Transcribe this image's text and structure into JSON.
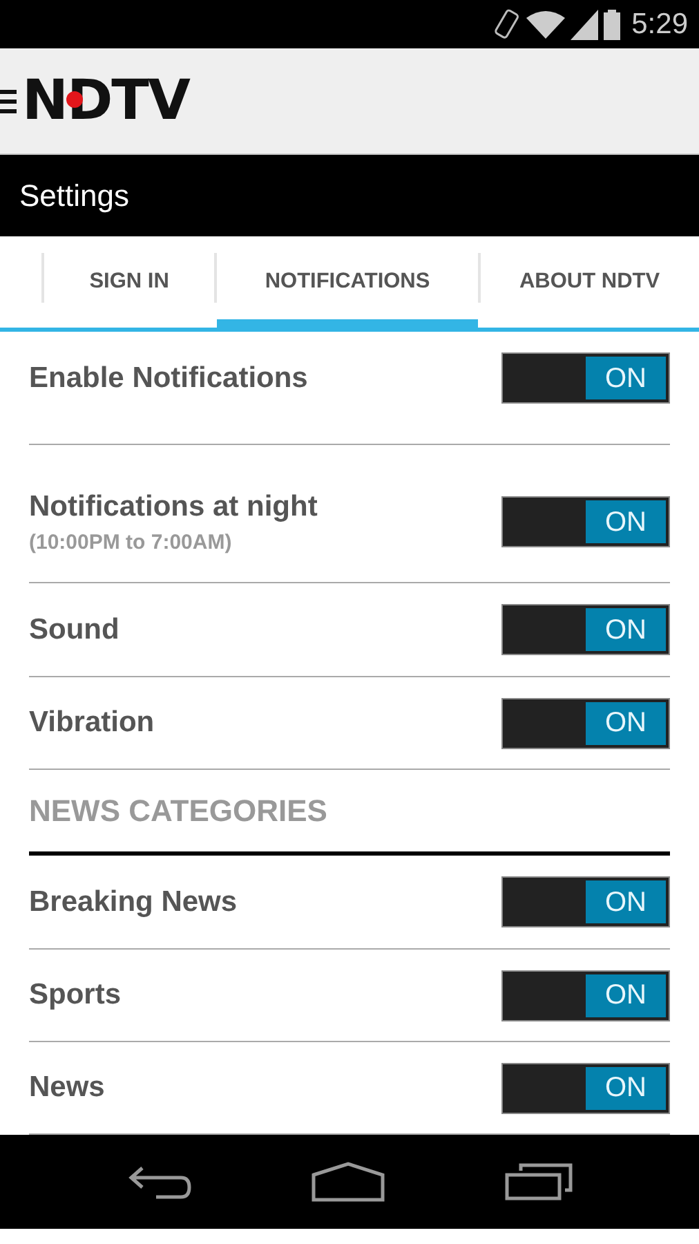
{
  "status_bar": {
    "time": "5:29"
  },
  "app_bar": {
    "logo": "NDTV"
  },
  "title": "Settings",
  "tabs": [
    {
      "label": "SIGN IN",
      "selected": false
    },
    {
      "label": "NOTIFICATIONS",
      "selected": true
    },
    {
      "label": "ABOUT NDTV",
      "selected": false
    }
  ],
  "settings": [
    {
      "label": "Enable Notifications",
      "on": true,
      "switch_text": "ON"
    },
    {
      "label": "Notifications at night",
      "sublabel": "(10:00PM to 7:00AM)",
      "on": true,
      "switch_text": "ON"
    },
    {
      "label": "Sound",
      "on": true,
      "switch_text": "ON"
    },
    {
      "label": "Vibration",
      "on": true,
      "switch_text": "ON"
    }
  ],
  "news_categories": {
    "heading": "NEWS CATEGORIES",
    "items": [
      {
        "label": "Breaking News",
        "on": true,
        "switch_text": "ON"
      },
      {
        "label": "Sports",
        "on": true,
        "switch_text": "ON"
      },
      {
        "label": "News",
        "on": true,
        "switch_text": "ON"
      }
    ]
  }
}
